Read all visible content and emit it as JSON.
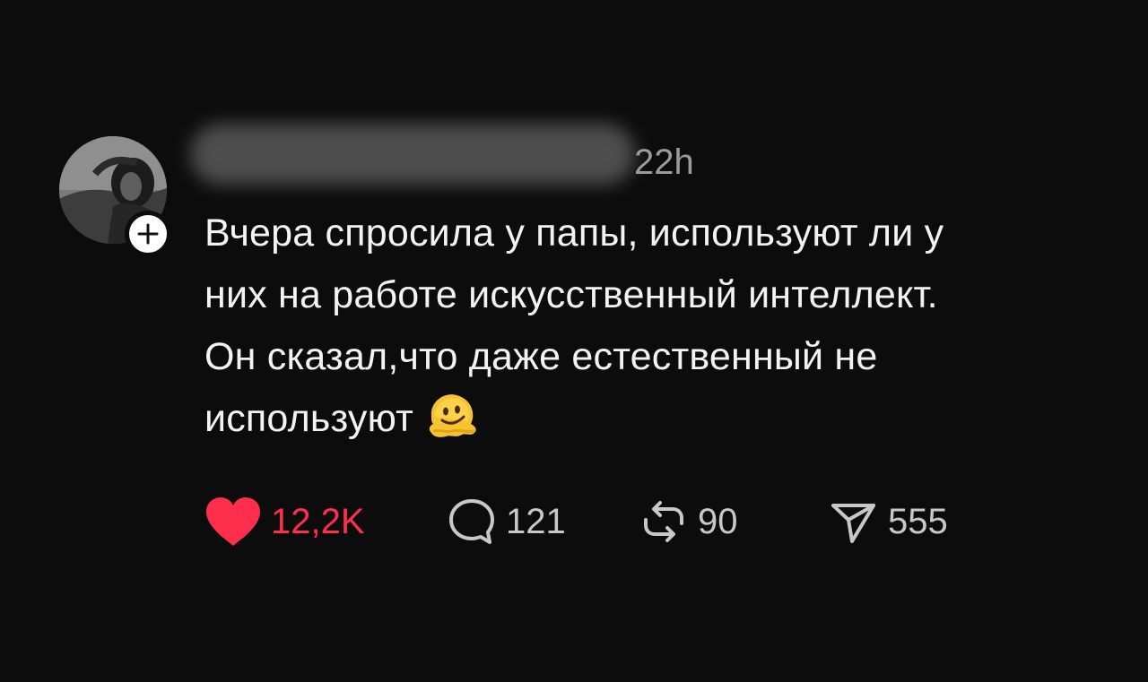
{
  "post": {
    "timestamp": "22h",
    "text_lines": [
      "Вчера спросила у папы, используют ли у",
      "них на работе искусственный интеллект.",
      "Он сказал,что даже естественный не",
      "используют"
    ],
    "emoji": "melting-face-emoji"
  },
  "actions": {
    "likes": "12,2K",
    "replies": "121",
    "reposts": "90",
    "shares": "555"
  },
  "colors": {
    "background": "#0d0c0d",
    "like": "#ff2e4d",
    "text": "#f3f3f3",
    "muted": "#9b9b9b"
  },
  "icons": {
    "like": "heart-icon",
    "reply": "speech-bubble-icon",
    "repost": "repost-arrows-icon",
    "share": "paper-plane-icon",
    "follow": "plus-icon"
  }
}
